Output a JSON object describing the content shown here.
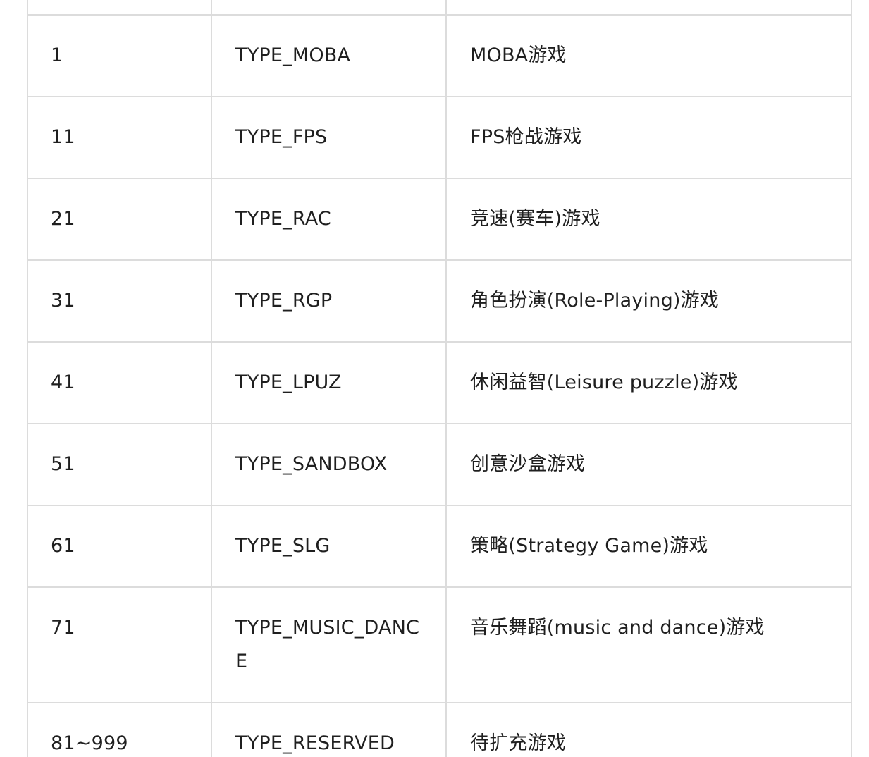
{
  "table": {
    "rows": [
      {
        "value": "1",
        "name": "TYPE_MOBA",
        "desc": "MOBA游戏"
      },
      {
        "value": "11",
        "name": "TYPE_FPS",
        "desc": "FPS枪战游戏"
      },
      {
        "value": "21",
        "name": "TYPE_RAC",
        "desc": "竞速(赛车)游戏"
      },
      {
        "value": "31",
        "name": "TYPE_RGP",
        "desc": "角色扮演(Role-Playing)游戏"
      },
      {
        "value": "41",
        "name": "TYPE_LPUZ",
        "desc": "休闲益智(Leisure puzzle)游戏"
      },
      {
        "value": "51",
        "name": "TYPE_SANDBOX",
        "desc": "创意沙盒游戏"
      },
      {
        "value": "61",
        "name": "TYPE_SLG",
        "desc": "策略(Strategy Game)游戏"
      },
      {
        "value": "71",
        "name": "TYPE_MUSIC_DANCE",
        "desc": "音乐舞蹈(music and dance)游戏"
      },
      {
        "value": "81~999",
        "name": "TYPE_RESERVED",
        "desc": "待扩充游戏"
      }
    ]
  }
}
